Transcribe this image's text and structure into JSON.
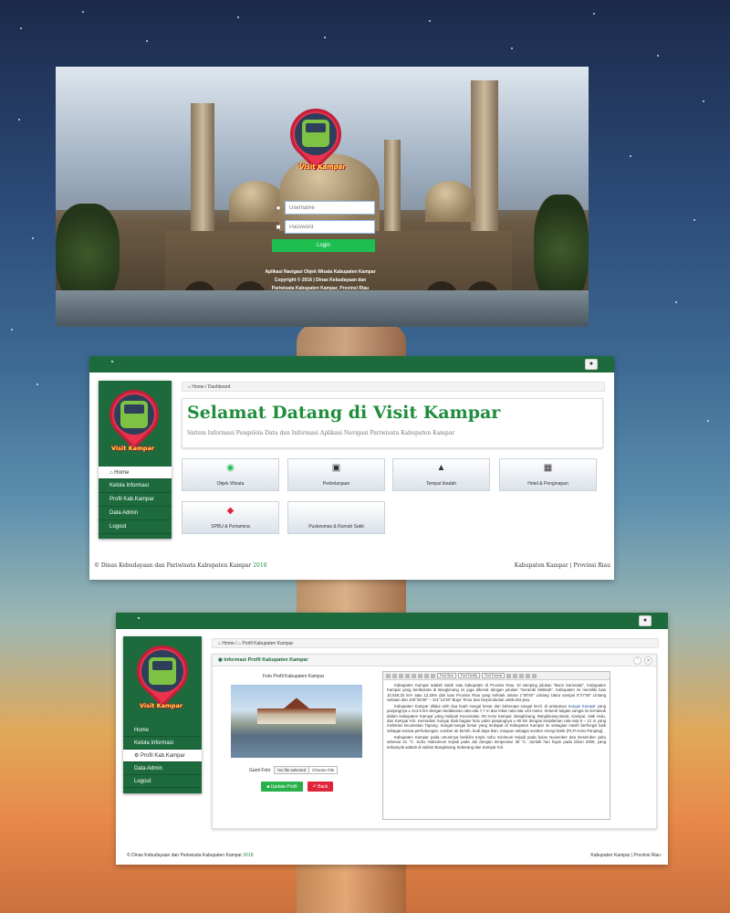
{
  "login": {
    "logo_text": "Visit Kampar",
    "username_placeholder": "Username",
    "password_placeholder": "Password",
    "login_button": "Login",
    "caption_line1": "Aplikasi Navigasi Objek Wisata Kabupaten Kampar",
    "caption_line2": "Copyright © 2016 | Dinas Kebudayaan dan",
    "caption_line3": "Pariwisata Kabupaten Kampar, Provinsi Riau"
  },
  "dashboard": {
    "logo_text": "Visit Kampar",
    "breadcrumb": "Home / Dashboard",
    "menu": [
      {
        "label": "Home",
        "icon": "home-icon"
      },
      {
        "label": "Kelola Informasi"
      },
      {
        "label": "Profil Kab.Kampar"
      },
      {
        "label": "Data Admin"
      },
      {
        "label": "Logout"
      }
    ],
    "welcome_title": "Selamat Datang di Visit Kampar",
    "welcome_subtitle": "Sistem Informasi Pengelola Data dan Informasi Aplikasi Navigasi Pariwisata Kabupaten Kampar",
    "tiles": [
      {
        "label": "Objek Wisata",
        "icon": "map-pin-icon",
        "glyph": "◉"
      },
      {
        "label": "Perbelanjaan",
        "icon": "shop-icon",
        "glyph": "▣"
      },
      {
        "label": "Tempat Ibadah",
        "icon": "mosque-icon",
        "glyph": "▲"
      },
      {
        "label": "Hotel & Penginapan",
        "icon": "hotel-icon",
        "glyph": "▦"
      },
      {
        "label": "SPBU & Pertamina",
        "icon": "pertamina-icon",
        "glyph": "◆"
      },
      {
        "label": "Puskesmas & Rumah Sakit",
        "icon": "hospital-icon",
        "glyph": ""
      }
    ],
    "footer_left": "© Dinas Kebudayaan dan Pariwisata Kabupaten Kampar",
    "footer_year": "2018",
    "footer_right": "Kabupaten Kampar | Provinsi Riau"
  },
  "profile": {
    "logo_text": "Visit Kampar",
    "breadcrumb_home": "Home",
    "breadcrumb_page": "Profil Kabupaten Kampar",
    "menu": [
      {
        "label": "Home"
      },
      {
        "label": "Kelola Informasi"
      },
      {
        "label": "Profil Kab.Kampar",
        "icon": "gear-icon"
      },
      {
        "label": "Data Admin"
      },
      {
        "label": "Logout"
      }
    ],
    "card_title": "Informasi Profil Kabupaten Kampar",
    "photo_title": "Foto Profil Kabupaten Kampar",
    "ganti_label": "Ganti Foto",
    "file_status": "No file selected",
    "file_button": "Choose File",
    "update_button": "Update Profil",
    "back_button": "Back",
    "font_size": "Font Size",
    "font_family": "Font Family",
    "font_format": "Font Format",
    "paragraph1": "Kabupaten Kampar adalah salah satu kabupaten di Provinsi Riau. Di samping julukan \"Bumi Sarimadu\", Kabupaten Kampar yang beribukota di Bangkinang ini juga dikenal dengan julukan \"Serambi Mekkah\". Kabupaten ini memiliki luas 10.928,20 km² atau 12,26% dari luas Provinsi Riau yang terletak antara 1°00'40\" Lintang Utara sampai 0°27'00\" Lintang Selatan dan 100°28'30\" – 101°14'30\" Bujur Timur dan berpenduduk ±688.204 jiwa.",
    "paragraph2_a": "Kabupaten Kampar dilalui oleh dua buah sungai besar dan beberapa sungai kecil, di antaranya",
    "paragraph2_link": "Sungai Kampar",
    "paragraph2_b": "yang panjangnya ± 413.5 km dengan kedalaman rata-rata 7,7 m dan lebar rata-rata 143 meter. Seluruh bagian sungai ini termasuk dalam Kabupaten Kampar yang meliputi Kecamatan XIII Koto Kampar, Bangkinang, Bangkinang Barat, Kampar, Siak Hulu, dan Kampar Kiri. Kemudian Sungai Siak bagian hulu yakni panjangnya ± 90 km dengan kedalaman rata-rata 8 – 12 m yang melintasi kecamatan Tapung. Sungai-sungai besar yang terdapat di Kabupaten Kampar ini sebagian masih berfungsi baik sebagai sarana perhubungan, sumber air bersih, budi daya ikan, maupun sebagai sumber energi listrik (PLTA Koto Panjang).",
    "paragraph3": "Kabupaten Kampar pada umumnya beriklim tropis suhu minimum terjadi pada bulan November dan Desember yaitu sebesar 21 °C. Suhu maksimum terjadi pada Juli dengan temperatur 35 °C. Jumlah hari hujan pada tahun 2009, yang terbanyak adalah di sekitar Bangkinang Seberang dan Kampar Kiri.",
    "footer_left": "© Dinas Kebudayaan dan Pariwisata Kabupaten Kampar",
    "footer_year": "2018",
    "footer_right": "Kabupaten Kampar | Provinsi Riau"
  },
  "colors": {
    "brand_green": "#1d6b3d",
    "login_green": "#1dbf51",
    "title_green": "#1f8e3c",
    "back_red": "#e0243a"
  }
}
